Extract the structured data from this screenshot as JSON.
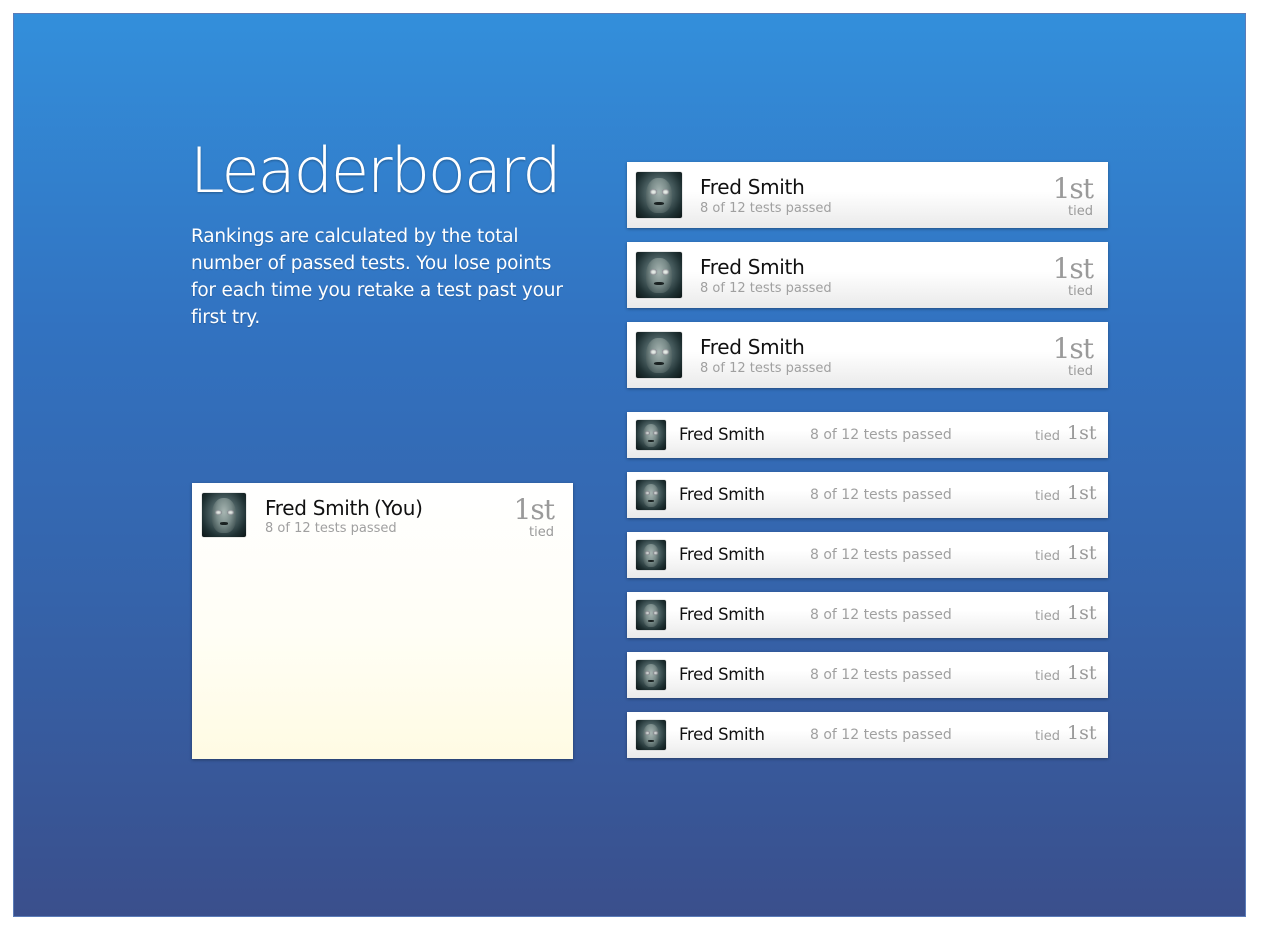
{
  "header": {
    "title": "Leaderboard",
    "description": "Rankings are calculated by the total number of passed tests. You lose points for each time you retake a test past your first try."
  },
  "top_entries": [
    {
      "name": "Fred Smith",
      "score": "8 of 12 tests passed",
      "rank": "1st",
      "status": "tied"
    },
    {
      "name": "Fred Smith",
      "score": "8 of 12 tests passed",
      "rank": "1st",
      "status": "tied"
    },
    {
      "name": "Fred Smith",
      "score": "8 of 12 tests passed",
      "rank": "1st",
      "status": "tied"
    }
  ],
  "entries": [
    {
      "name": "Fred Smith",
      "score": "8 of 12 tests passed",
      "rank": "1st",
      "status": "tied"
    },
    {
      "name": "Fred Smith",
      "score": "8 of 12 tests passed",
      "rank": "1st",
      "status": "tied"
    },
    {
      "name": "Fred Smith",
      "score": "8 of 12 tests passed",
      "rank": "1st",
      "status": "tied"
    },
    {
      "name": "Fred Smith",
      "score": "8 of 12 tests passed",
      "rank": "1st",
      "status": "tied"
    },
    {
      "name": "Fred Smith",
      "score": "8 of 12 tests passed",
      "rank": "1st",
      "status": "tied"
    },
    {
      "name": "Fred Smith",
      "score": "8 of 12 tests passed",
      "rank": "1st",
      "status": "tied"
    }
  ],
  "current_user": {
    "name": "Fred Smith",
    "you_label": "(You)",
    "score": "8 of 12 tests passed",
    "rank": "1st",
    "status": "tied"
  },
  "icons": {
    "avatar": "user-avatar-icon"
  },
  "colors": {
    "background_top": "#338fdb",
    "background_bottom": "#3a4f8c",
    "card": "#ffffff",
    "you_card": "#fffbe3",
    "muted_text": "#a0a0a0"
  }
}
